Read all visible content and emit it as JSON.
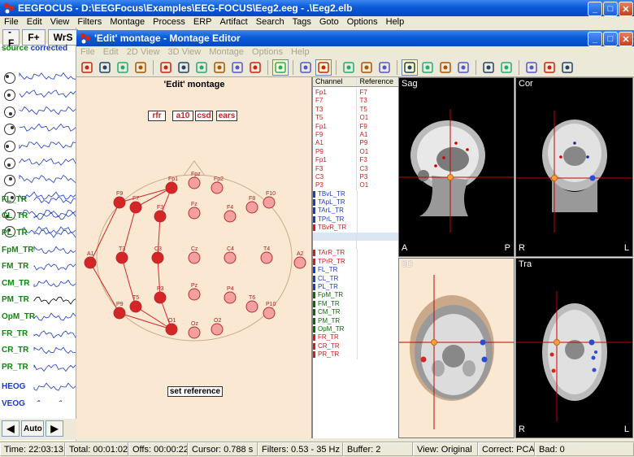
{
  "main": {
    "title": "EEGFOCUS - D:\\EEGFocus\\Examples\\EEG-FOCUS\\Eeg2.eeg - .\\Eeg2.elb",
    "menu": [
      "File",
      "Edit",
      "View",
      "Filters",
      "Montage",
      "Process",
      "ERP",
      "Artifact",
      "Search",
      "Tags",
      "Goto",
      "Options",
      "Help"
    ],
    "toolbar": {
      "minus_f": "-F",
      "plus_f": "F+",
      "wrs": "WrS"
    },
    "source_label": "source",
    "corrected_label": "corrected",
    "channels": [
      {
        "label": "FL_TR",
        "color": "green"
      },
      {
        "label": "CL_TR",
        "color": "green"
      },
      {
        "label": "PL_TR",
        "color": "green"
      },
      {
        "label": "FpM_TR",
        "color": "green"
      },
      {
        "label": "FM_TR",
        "color": "green"
      },
      {
        "label": "CM_TR",
        "color": "green"
      },
      {
        "label": "PM_TR",
        "color": "green"
      },
      {
        "label": "OpM_TR",
        "color": "green"
      },
      {
        "label": "FR_TR",
        "color": "green"
      },
      {
        "label": "CR_TR",
        "color": "green"
      },
      {
        "label": "PR_TR",
        "color": "green"
      },
      {
        "label": "HEOG",
        "color": "blue"
      },
      {
        "label": "VEOG",
        "color": "blue"
      }
    ],
    "auto_label": "Auto"
  },
  "editor": {
    "title": "'Edit' montage - Montage Editor",
    "menu": [
      "File",
      "Edit",
      "2D View",
      "3D View",
      "Montage",
      "Options",
      "Help"
    ],
    "montage_title": "'Edit' montage",
    "ref_buttons": [
      "rfr",
      "a10",
      "csd",
      "ears"
    ],
    "set_reference_label": "set reference",
    "table_headers": {
      "channel": "Channel",
      "reference": "Reference"
    },
    "rows": [
      {
        "ch": "Fp1",
        "ref": "F7",
        "ch_color": "#c8201c",
        "ref_color": "#c8201c"
      },
      {
        "ch": "F7",
        "ref": "T3",
        "ch_color": "#c8201c",
        "ref_color": "#c8201c"
      },
      {
        "ch": "T3",
        "ref": "T5",
        "ch_color": "#c8201c",
        "ref_color": "#c8201c"
      },
      {
        "ch": "T5",
        "ref": "O1",
        "ch_color": "#c8201c",
        "ref_color": "#c8201c"
      },
      {
        "ch": "Fp1",
        "ref": "F9",
        "ch_color": "#c8201c",
        "ref_color": "#c8201c"
      },
      {
        "ch": "F9",
        "ref": "A1",
        "ch_color": "#c8201c",
        "ref_color": "#c8201c"
      },
      {
        "ch": "A1",
        "ref": "P9",
        "ch_color": "#c8201c",
        "ref_color": "#c8201c"
      },
      {
        "ch": "P9",
        "ref": "O1",
        "ch_color": "#c8201c",
        "ref_color": "#c8201c"
      },
      {
        "ch": "Fp1",
        "ref": "F3",
        "ch_color": "#c8201c",
        "ref_color": "#c8201c"
      },
      {
        "ch": "F3",
        "ref": "C3",
        "ch_color": "#c8201c",
        "ref_color": "#c8201c"
      },
      {
        "ch": "C3",
        "ref": "P3",
        "ch_color": "#c8201c",
        "ref_color": "#c8201c"
      },
      {
        "ch": "P3",
        "ref": "O1",
        "ch_color": "#c8201c",
        "ref_color": "#c8201c"
      },
      {
        "ch": "TBvL_TR",
        "ref": "",
        "ch_color": "#1a3ac8",
        "bar": "#1a3ac8"
      },
      {
        "ch": "TApL_TR",
        "ref": "",
        "ch_color": "#1a3ac8",
        "bar": "#1a3ac8"
      },
      {
        "ch": "TArL_TR",
        "ref": "",
        "ch_color": "#1a3ac8",
        "bar": "#1a3ac8"
      },
      {
        "ch": "TPrL_TR",
        "ref": "",
        "ch_color": "#1a3ac8",
        "bar": "#1a3ac8"
      },
      {
        "ch": "TBvR_TR",
        "ref": "",
        "ch_color": "#c8201c",
        "bar": "#c8201c"
      },
      {
        "ch": "",
        "ref": "",
        "ch_color": "#000",
        "selected": true
      },
      {
        "ch": "",
        "ref": "",
        "ch_color": "#000"
      },
      {
        "ch": "TArR_TR",
        "ref": "",
        "ch_color": "#c8201c",
        "bar": "#c8201c"
      },
      {
        "ch": "TPrR_TR",
        "ref": "",
        "ch_color": "#c8201c",
        "bar": "#c8201c"
      },
      {
        "ch": "FL_TR",
        "ref": "",
        "ch_color": "#1a3ac8",
        "bar": "#1a3ac8"
      },
      {
        "ch": "CL_TR",
        "ref": "",
        "ch_color": "#1a3ac8",
        "bar": "#1a3ac8"
      },
      {
        "ch": "PL_TR",
        "ref": "",
        "ch_color": "#1a3ac8",
        "bar": "#1a3ac8"
      },
      {
        "ch": "FpM_TR",
        "ref": "",
        "ch_color": "#0a6a0a",
        "bar": "#0a6a0a"
      },
      {
        "ch": "FM_TR",
        "ref": "",
        "ch_color": "#0a6a0a",
        "bar": "#0a6a0a"
      },
      {
        "ch": "CM_TR",
        "ref": "",
        "ch_color": "#0a6a0a",
        "bar": "#0a6a0a"
      },
      {
        "ch": "PM_TR",
        "ref": "",
        "ch_color": "#0a6a0a",
        "bar": "#0a6a0a"
      },
      {
        "ch": "OpM_TR",
        "ref": "",
        "ch_color": "#0a6a0a",
        "bar": "#0a6a0a"
      },
      {
        "ch": "FR_TR",
        "ref": "",
        "ch_color": "#c8201c",
        "bar": "#c8201c"
      },
      {
        "ch": "CR_TR",
        "ref": "",
        "ch_color": "#c8201c",
        "bar": "#c8201c"
      },
      {
        "ch": "PR_TR",
        "ref": "",
        "ch_color": "#c8201c",
        "bar": "#c8201c"
      }
    ],
    "electrodes": [
      {
        "label": "Fp1",
        "sel": true
      },
      {
        "label": "Fpz",
        "sel": false
      },
      {
        "label": "Fp2",
        "sel": false
      },
      {
        "label": "F9",
        "sel": true
      },
      {
        "label": "F7",
        "sel": true
      },
      {
        "label": "F3",
        "sel": true
      },
      {
        "label": "Fz",
        "sel": false
      },
      {
        "label": "F4",
        "sel": false
      },
      {
        "label": "F8",
        "sel": false
      },
      {
        "label": "F10",
        "sel": false
      },
      {
        "label": "A1",
        "sel": true
      },
      {
        "label": "T3",
        "sel": true
      },
      {
        "label": "C3",
        "sel": true
      },
      {
        "label": "Cz",
        "sel": false
      },
      {
        "label": "C4",
        "sel": false
      },
      {
        "label": "T4",
        "sel": false
      },
      {
        "label": "A2",
        "sel": false
      },
      {
        "label": "P9",
        "sel": true
      },
      {
        "label": "T5",
        "sel": true
      },
      {
        "label": "P3",
        "sel": true
      },
      {
        "label": "Pz",
        "sel": false
      },
      {
        "label": "P4",
        "sel": false
      },
      {
        "label": "T6",
        "sel": false
      },
      {
        "label": "P10",
        "sel": false
      },
      {
        "label": "O1",
        "sel": true
      },
      {
        "label": "Oz",
        "sel": false
      },
      {
        "label": "O2",
        "sel": false
      }
    ],
    "views": {
      "sag": {
        "name": "Sag",
        "left": "A",
        "right": "P"
      },
      "cor": {
        "name": "Cor",
        "left": "R",
        "right": "L"
      },
      "threed": {
        "name": "3D"
      },
      "tra": {
        "name": "Tra",
        "left": "R",
        "right": "L"
      }
    }
  },
  "status": {
    "time": "Time: 22:03:13",
    "total": "Total: 00:01:02",
    "offs": "Offs: 00:00:22",
    "cursor": "Cursor: 0.788 s",
    "filters": "Filters: 0.53 - 35 Hz",
    "buffer": "Buffer: 2",
    "view": "View: Original",
    "correct": "Correct: PCA",
    "bad": "Bad: 0"
  },
  "colors": {
    "accent": "#0a5bd8",
    "electrode_sel": "#d42626",
    "electrode": "#f4a0a0",
    "montage_bg": "#fbe8d2"
  }
}
